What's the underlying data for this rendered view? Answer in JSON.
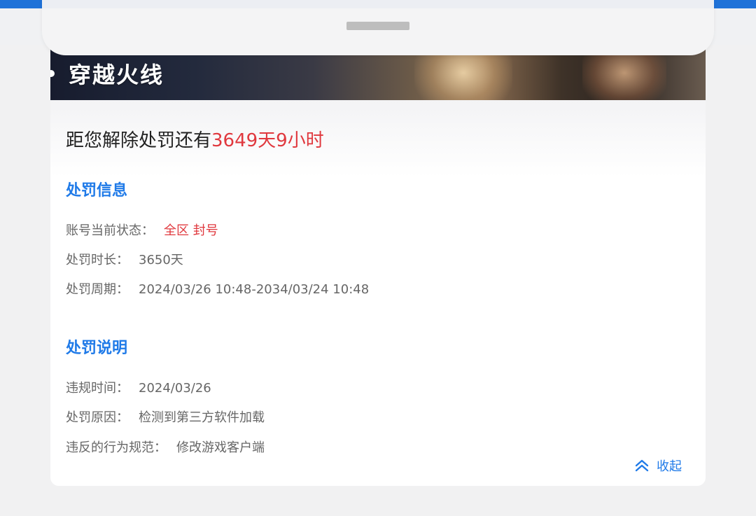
{
  "banner": {
    "title": "穿越火线"
  },
  "countdown": {
    "prefix": "距您解除处罚还有",
    "remaining": "3649天9小时"
  },
  "punishment_info": {
    "title": "处罚信息",
    "rows": [
      {
        "label": "账号当前状态：",
        "value": "全区 封号"
      },
      {
        "label": "处罚时长：",
        "value": "3650天"
      },
      {
        "label": "处罚周期：",
        "value": "2024/03/26 10:48-2034/03/24 10:48"
      }
    ]
  },
  "punishment_desc": {
    "title": "处罚说明",
    "rows": [
      {
        "label": "违规时间：",
        "value": "2024/03/26"
      },
      {
        "label": "处罚原因：",
        "value": "检测到第三方软件加载"
      },
      {
        "label": "违反的行为规范：",
        "value": "修改游戏客户端"
      }
    ]
  },
  "collapse": {
    "label": "收起",
    "icon": "double-chevron-up-icon"
  },
  "colors": {
    "accent_blue": "#1f7ae8",
    "alert_red": "#e0383e"
  }
}
